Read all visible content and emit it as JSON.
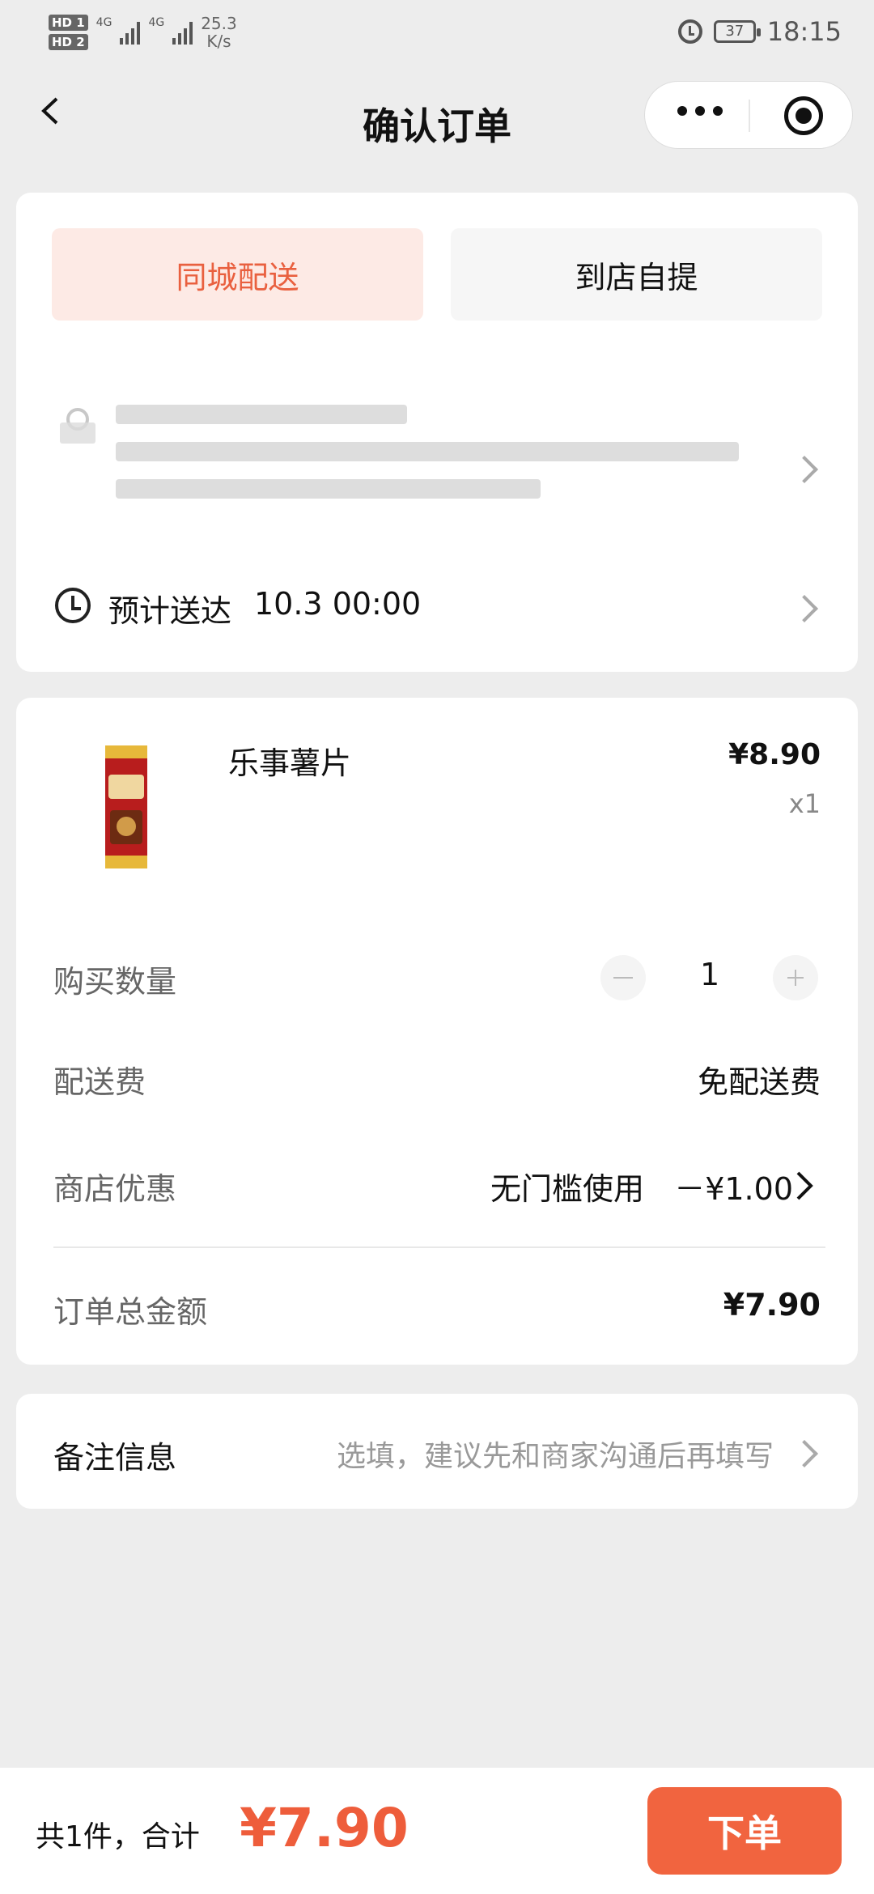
{
  "status_bar": {
    "hd1": "HD 1",
    "hd2": "HD 2",
    "sig1": "4G",
    "sig2": "4G",
    "speed_value": "25.3",
    "speed_unit": "K/s",
    "battery": "37",
    "time": "18:15"
  },
  "nav": {
    "title": "确认订单",
    "back_icon": "chevron-left-icon",
    "more_icon": "more-dots-icon",
    "close_icon": "target-icon"
  },
  "delivery": {
    "tabs": [
      {
        "label": "同城配送",
        "active": true
      },
      {
        "label": "到店自提",
        "active": false
      }
    ],
    "eta_label": "预计送达",
    "eta_time": "10.3 00:00"
  },
  "product": {
    "name": "乐事薯片",
    "price": "¥8.90",
    "qty": "x1"
  },
  "order": {
    "quantity_label": "购买数量",
    "quantity_value": "1",
    "delivery_fee_label": "配送费",
    "delivery_fee_value": "免配送费",
    "discount_label": "商店优惠",
    "discount_desc": "无门槛使用",
    "discount_value": "－¥1.00",
    "total_label": "订单总金额",
    "total_value": "¥7.90"
  },
  "notes": {
    "label": "备注信息",
    "placeholder": "选填，建议先和商家沟通后再填写"
  },
  "bottom_bar": {
    "summary": "共1件，合计",
    "total": "¥7.90",
    "submit": "下单"
  },
  "colors": {
    "accent": "#f1643f",
    "accent_text": "#e9603f",
    "active_tab_bg": "#fdeae5",
    "page_bg": "#ededed"
  }
}
